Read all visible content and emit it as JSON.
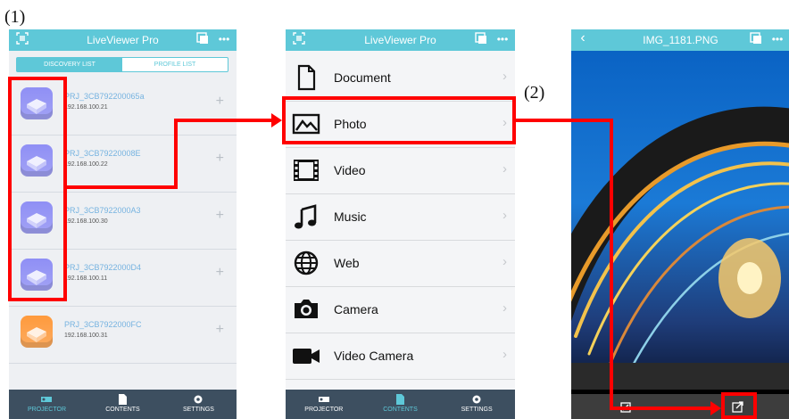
{
  "steps": {
    "one": "(1)",
    "two": "(2)"
  },
  "app": {
    "title": "LiveViewer Pro",
    "accent": "#5ec8d8",
    "tabbar_bg": "#3d4f60",
    "tabs": [
      {
        "label": "PROJECTOR",
        "icon": "projector-icon"
      },
      {
        "label": "CONTENTS",
        "icon": "document-icon"
      },
      {
        "label": "SETTINGS",
        "icon": "gear-icon"
      }
    ]
  },
  "discovery": {
    "segments": [
      "DISCOVERY LIST",
      "PROFILE LIST"
    ],
    "devices": [
      {
        "name": "PRJ_3CB792200065a",
        "ip": "192.168.100.21",
        "color": "#8f8ff5"
      },
      {
        "name": "PRJ_3CB79220008E",
        "ip": "192.168.100.22",
        "color": "#8f8ff5"
      },
      {
        "name": "PRJ_3CB7922000A3",
        "ip": "192.168.100.30",
        "color": "#8f8ff5"
      },
      {
        "name": "PRJ_3CB7922000D4",
        "ip": "192.168.100.11",
        "color": "#8f8ff5"
      },
      {
        "name": "PRJ_3CB7922000FC",
        "ip": "192.168.100.31",
        "color": "#ff9a3c"
      }
    ]
  },
  "contents": {
    "items": [
      {
        "label": "Document",
        "icon": "document-icon"
      },
      {
        "label": "Photo",
        "icon": "photo-icon"
      },
      {
        "label": "Video",
        "icon": "film-icon"
      },
      {
        "label": "Music",
        "icon": "music-note-icon"
      },
      {
        "label": "Web",
        "icon": "globe-icon"
      },
      {
        "label": "Camera",
        "icon": "camera-icon"
      },
      {
        "label": "Video Camera",
        "icon": "video-camera-icon"
      }
    ]
  },
  "viewer": {
    "title": "IMG_1181.PNG",
    "back": "‹"
  },
  "highlight_color": "#ff0000"
}
